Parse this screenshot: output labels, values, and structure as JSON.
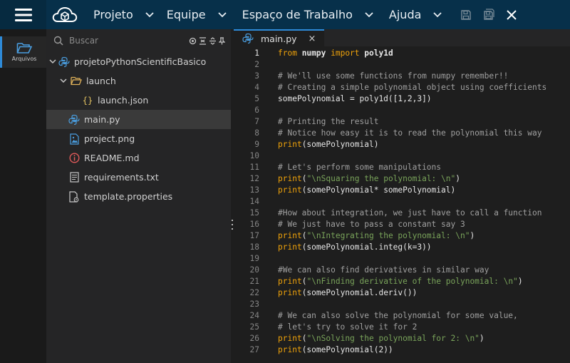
{
  "menu": {
    "items": [
      {
        "label": "Projeto"
      },
      {
        "label": "Equipe"
      },
      {
        "label": "Espaço de Trabalho"
      },
      {
        "label": "Ajuda"
      }
    ]
  },
  "activity": {
    "files_label": "Arquivos"
  },
  "sidebar": {
    "search_placeholder": "Buscar",
    "tree": [
      {
        "label": "projetoPythonScientificBasico"
      },
      {
        "label": "launch"
      },
      {
        "label": "launch.json"
      },
      {
        "label": "main.py"
      },
      {
        "label": "project.png"
      },
      {
        "label": "README.md"
      },
      {
        "label": "requirements.txt"
      },
      {
        "label": "template.properties"
      }
    ]
  },
  "editor": {
    "tab_label": "main.py",
    "tab_close": "×",
    "active_line": 1,
    "lines": [
      {
        "n": "1",
        "tokens": [
          {
            "t": "from",
            "c": "kw"
          },
          {
            "t": " numpy ",
            "c": "pl bold"
          },
          {
            "t": "import",
            "c": "kw"
          },
          {
            "t": " poly1d",
            "c": "pl bold"
          }
        ]
      },
      {
        "n": "2",
        "tokens": []
      },
      {
        "n": "3",
        "tokens": [
          {
            "t": "# We'll use some functions from numpy remember!!",
            "c": "cm"
          }
        ]
      },
      {
        "n": "4",
        "tokens": [
          {
            "t": "# Creating a simple polynomial object using coefficients",
            "c": "cm"
          }
        ]
      },
      {
        "n": "5",
        "tokens": [
          {
            "t": "somePolynomial = poly1d([1,2,3])",
            "c": "pl"
          }
        ]
      },
      {
        "n": "6",
        "tokens": []
      },
      {
        "n": "7",
        "tokens": [
          {
            "t": "# Printing the result",
            "c": "cm"
          }
        ]
      },
      {
        "n": "8",
        "tokens": [
          {
            "t": "# Notice how easy it is to read the polynomial this way",
            "c": "cm"
          }
        ]
      },
      {
        "n": "9",
        "tokens": [
          {
            "t": "print",
            "c": "kw"
          },
          {
            "t": "(somePolynomial)",
            "c": "pl"
          }
        ]
      },
      {
        "n": "10",
        "tokens": []
      },
      {
        "n": "11",
        "tokens": [
          {
            "t": "# Let's perform some manipulations",
            "c": "cm"
          }
        ]
      },
      {
        "n": "12",
        "tokens": [
          {
            "t": "print",
            "c": "kw"
          },
          {
            "t": "(",
            "c": "pl"
          },
          {
            "t": "\"\\nSquaring the polynomial: \\n\"",
            "c": "str"
          },
          {
            "t": ")",
            "c": "pl"
          }
        ]
      },
      {
        "n": "13",
        "tokens": [
          {
            "t": "print",
            "c": "kw"
          },
          {
            "t": "(somePolynomial* somePolynomial)",
            "c": "pl"
          }
        ]
      },
      {
        "n": "14",
        "tokens": []
      },
      {
        "n": "15",
        "tokens": [
          {
            "t": "#How about integration, we just have to call a function",
            "c": "cm"
          }
        ]
      },
      {
        "n": "16",
        "tokens": [
          {
            "t": "# We just have to pass a constant say 3",
            "c": "cm"
          }
        ]
      },
      {
        "n": "17",
        "tokens": [
          {
            "t": "print",
            "c": "kw"
          },
          {
            "t": "(",
            "c": "pl"
          },
          {
            "t": "\"\\nIntegrating the polynomial: \\n\"",
            "c": "str"
          },
          {
            "t": ")",
            "c": "pl"
          }
        ]
      },
      {
        "n": "18",
        "tokens": [
          {
            "t": "print",
            "c": "kw"
          },
          {
            "t": "(somePolynomial.integ(k=3))",
            "c": "pl"
          }
        ]
      },
      {
        "n": "19",
        "tokens": []
      },
      {
        "n": "20",
        "tokens": [
          {
            "t": "#We can also find derivatives in similar way",
            "c": "cm"
          }
        ]
      },
      {
        "n": "21",
        "tokens": [
          {
            "t": "print",
            "c": "kw"
          },
          {
            "t": "(",
            "c": "pl"
          },
          {
            "t": "\"\\nFinding derivative of the polynomial: \\n\"",
            "c": "str"
          },
          {
            "t": ")",
            "c": "pl"
          }
        ]
      },
      {
        "n": "22",
        "tokens": [
          {
            "t": "print",
            "c": "kw"
          },
          {
            "t": "(somePolynomial.deriv())",
            "c": "pl"
          }
        ]
      },
      {
        "n": "23",
        "tokens": []
      },
      {
        "n": "24",
        "tokens": [
          {
            "t": "# We can also solve the polynomial for some value,",
            "c": "cm"
          }
        ]
      },
      {
        "n": "25",
        "tokens": [
          {
            "t": "# let's try to solve it for 2",
            "c": "cm"
          }
        ]
      },
      {
        "n": "26",
        "tokens": [
          {
            "t": "print",
            "c": "kw"
          },
          {
            "t": "(",
            "c": "pl"
          },
          {
            "t": "\"\\nSolving the polynomial for 2: \\n\"",
            "c": "str"
          },
          {
            "t": ")",
            "c": "pl"
          }
        ]
      },
      {
        "n": "27",
        "tokens": [
          {
            "t": "print",
            "c": "kw"
          },
          {
            "t": "(somePolynomial(2))",
            "c": "pl"
          }
        ]
      }
    ]
  },
  "colors": {
    "topbar": "#07304a",
    "accent": "#2e8ad8",
    "keyword": "#f0a30a",
    "comment": "#a0a0a0",
    "string": "#79a35a"
  }
}
